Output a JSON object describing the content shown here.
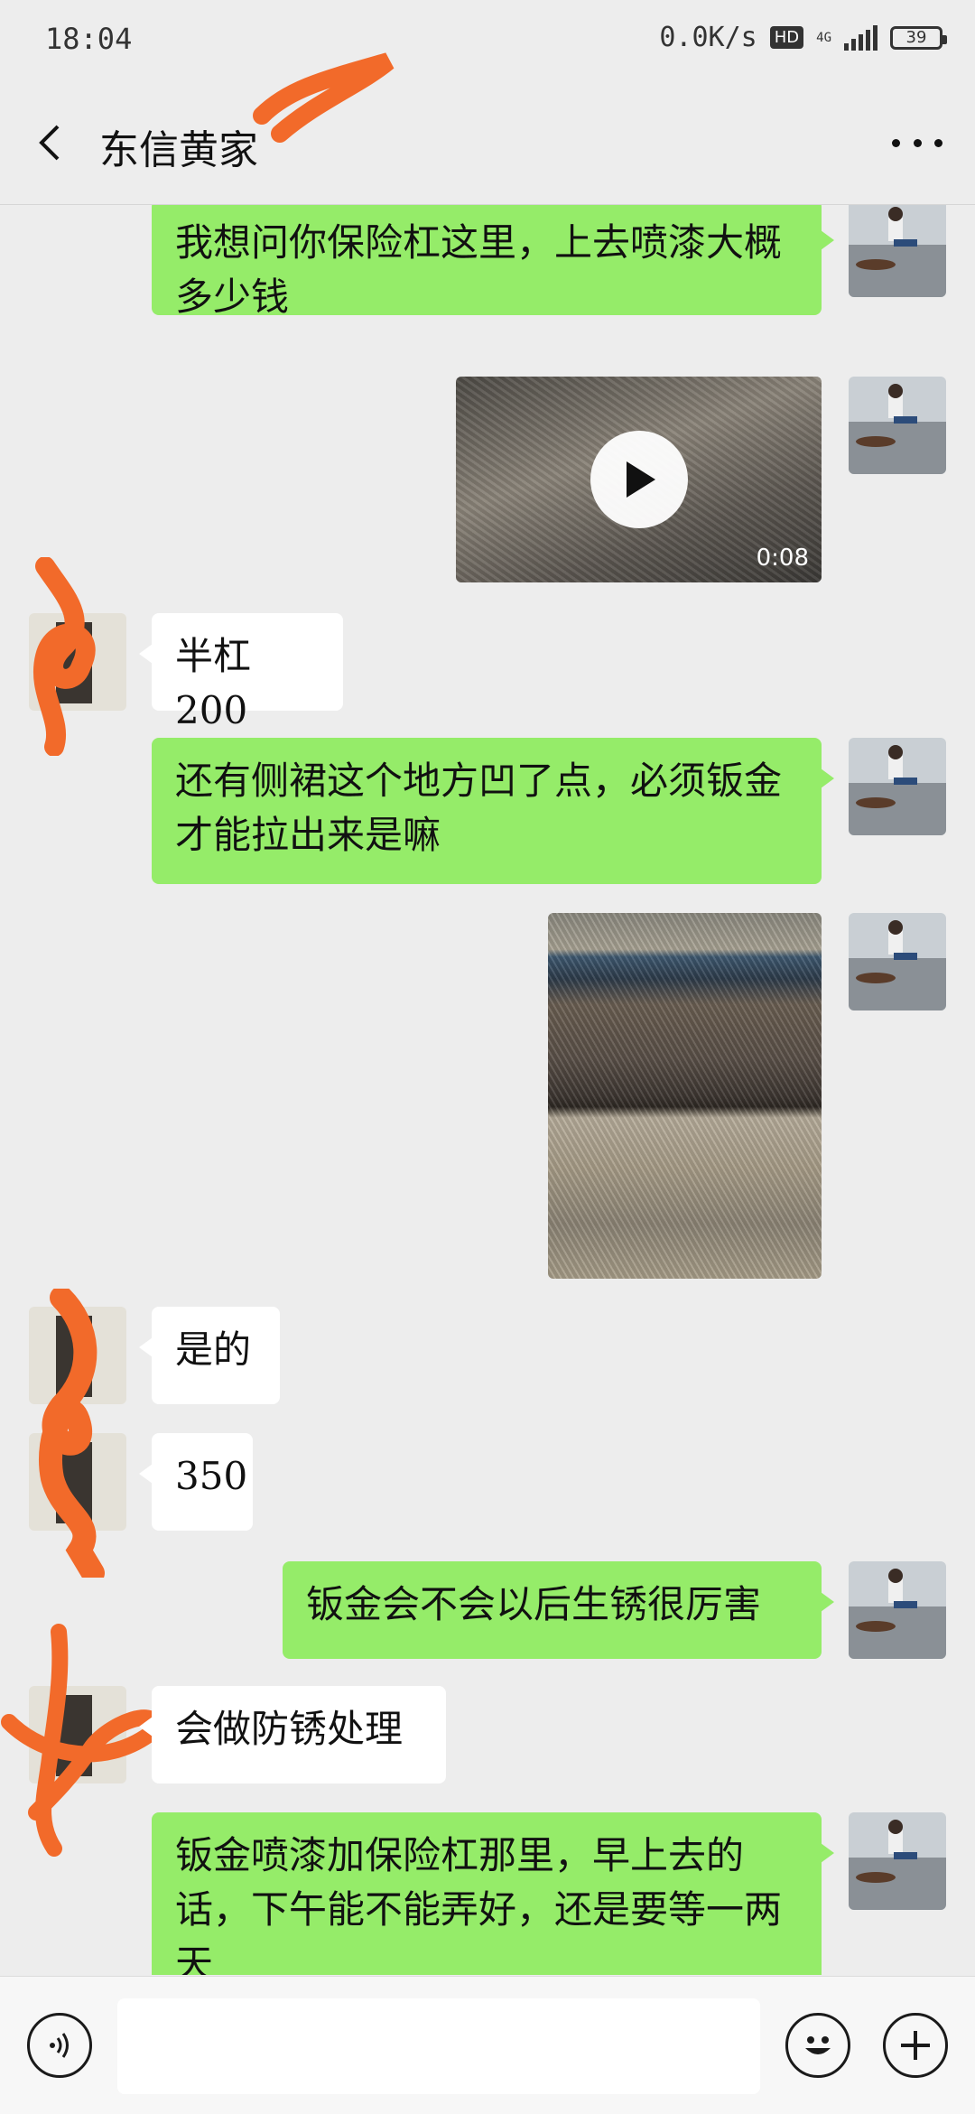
{
  "status_bar": {
    "time": "18:04",
    "network_speed": "0.0K/s",
    "hd_badge": "HD",
    "network_type": "4G",
    "battery": "39"
  },
  "header": {
    "title": "东信黄家",
    "back_icon": "back-chevron-icon",
    "more_icon": "more-dots-icon"
  },
  "messages": [
    {
      "sender": "me",
      "type": "text",
      "text": "我想问你保险杠这里，上去喷漆大概多少钱"
    },
    {
      "sender": "me",
      "type": "video",
      "duration": "0:08"
    },
    {
      "sender": "them",
      "type": "text",
      "text": "半杠200"
    },
    {
      "sender": "me",
      "type": "text",
      "text": "还有侧裙这个地方凹了点，必须钣金才能拉出来是嘛"
    },
    {
      "sender": "me",
      "type": "image"
    },
    {
      "sender": "them",
      "type": "text",
      "text": "是的"
    },
    {
      "sender": "them",
      "type": "text",
      "text": "350"
    },
    {
      "sender": "me",
      "type": "text",
      "text": "钣金会不会以后生锈很厉害"
    },
    {
      "sender": "them",
      "type": "text",
      "text": "会做防锈处理"
    },
    {
      "sender": "me",
      "type": "text",
      "text": "钣金喷漆加保险杠那里，早上去的话，下午能不能弄好，还是要等一两天"
    }
  ],
  "input_bar": {
    "voice_icon": "voice-icon",
    "text_value": "",
    "emoji_icon": "emoji-icon",
    "plus_icon": "plus-icon"
  },
  "colors": {
    "background": "#ededed",
    "my_bubble": "#95ec69",
    "their_bubble": "#ffffff",
    "redaction": "#f26a2a"
  }
}
